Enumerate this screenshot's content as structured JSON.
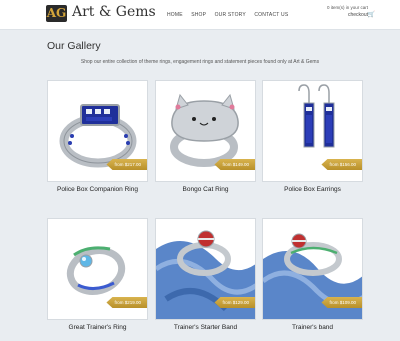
{
  "header": {
    "brand": "Art & Gems",
    "logo_mark": "AG",
    "nav": [
      "HOME",
      "SHOP",
      "OUR STORY",
      "CONTACT US"
    ],
    "cart_summary": "0 item(s) in your cart",
    "checkout_label": "checkout",
    "cart_icon": "shopping-cart-icon"
  },
  "gallery": {
    "title": "Our Gallery",
    "subtitle": "Shop our entire collection of theme rings, engagement rings and statement pieces found only at Art & Gems"
  },
  "products": [
    {
      "name": "Police Box Companion Ring",
      "price": "from $217.00"
    },
    {
      "name": "Bongo Cat Ring",
      "price": "from $149.00"
    },
    {
      "name": "Police Box Earrings",
      "price": "from $156.00"
    },
    {
      "name": "Great Trainer's Ring",
      "price": "from $219.00"
    },
    {
      "name": "Trainer's Starter Band",
      "price": "from $129.00"
    },
    {
      "name": "Trainer's band",
      "price": "from $109.00"
    }
  ],
  "colors": {
    "background": "#e9edf1",
    "price_tag": "#c9a23c",
    "sapphire": "#1f2f9a",
    "silver": "#b9bec4"
  }
}
